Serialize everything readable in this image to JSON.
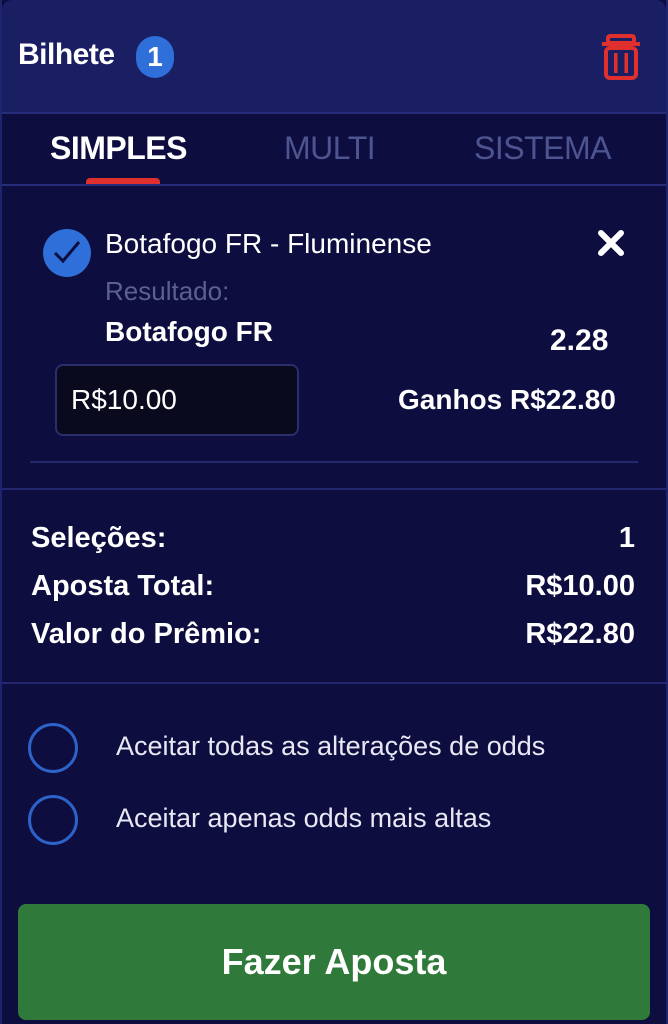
{
  "header": {
    "title": "Bilhete",
    "badge_count": "1",
    "trash_icon": "trash-icon"
  },
  "tabs": [
    {
      "label": "SIMPLES",
      "active": true
    },
    {
      "label": "MULTI",
      "active": false
    },
    {
      "label": "SISTEMA",
      "active": false
    }
  ],
  "selection": {
    "match": "Botafogo FR - Fluminense",
    "market": "Resultado:",
    "pick": "Botafogo FR",
    "odds": "2.28",
    "stake_value": "R$10.00",
    "winnings": "Ganhos R$22.80"
  },
  "summary": [
    {
      "label": "Seleções:",
      "value": "1"
    },
    {
      "label": "Aposta Total:",
      "value": "R$10.00"
    },
    {
      "label": "Valor do Prêmio:",
      "value": "R$22.80"
    }
  ],
  "options": [
    {
      "label": "Aceitar todas as alterações de odds"
    },
    {
      "label": "Aceitar apenas odds mais altas"
    }
  ],
  "bet_button": {
    "label": "Fazer Aposta"
  },
  "colors": {
    "background": "#0d0d3f",
    "header": "#1a1f63",
    "accent_red": "#e0302e",
    "accent_blue": "#2f6fd9",
    "button_green": "#2f7a3a"
  }
}
